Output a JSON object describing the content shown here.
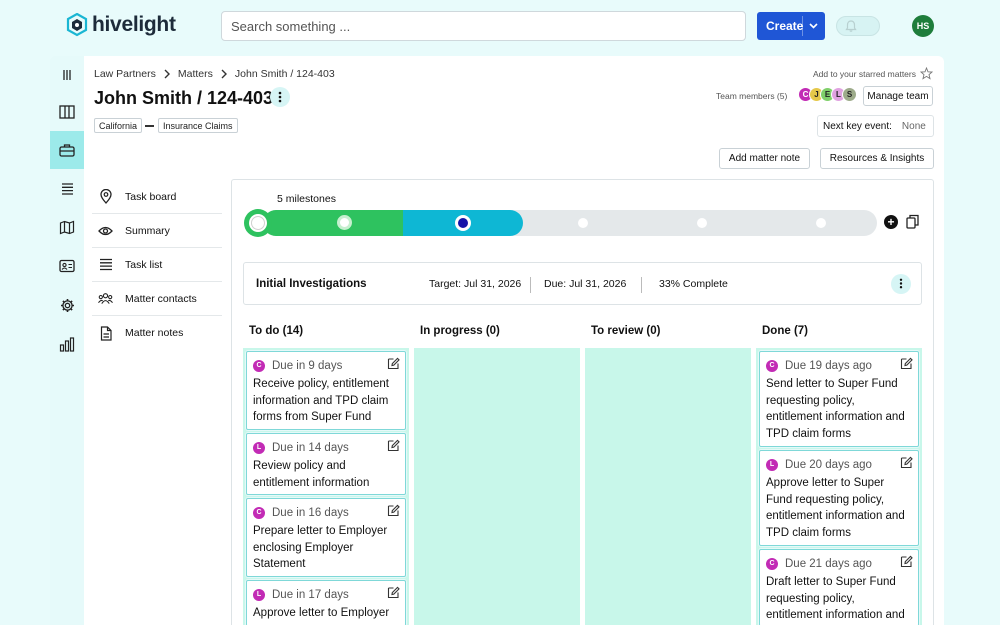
{
  "app": {
    "logo_text": "hivelight"
  },
  "search": {
    "placeholder": "Search something ..."
  },
  "header": {
    "create_label": "Create",
    "user_initials": "HS"
  },
  "breadcrumb": [
    "Law Partners",
    "Matters",
    "John Smith / 124-403"
  ],
  "matter": {
    "title": "John Smith / 124-403",
    "tags": [
      "California",
      "Insurance Claims"
    ],
    "starred_label": "Add to your starred matters",
    "team_label": "Team members (5)",
    "team_members": [
      "C",
      "J",
      "E",
      "L",
      "S"
    ],
    "manage_team_label": "Manage team",
    "next_key_event_label": "Next key event:",
    "next_key_event_value": "None",
    "add_note_label": "Add matter note",
    "resources_label": "Resources & Insights"
  },
  "colors": {
    "accent": "#1f56d6",
    "milestone_done": "#2ec25f",
    "milestone_current": "#0eb7d4",
    "column_bg": "#c8f7ea",
    "avatar_c": "#c22bb5",
    "avatar_l": "#c22bb5"
  },
  "sidenav": [
    {
      "label": "Task board",
      "icon": "location-pin-icon"
    },
    {
      "label": "Summary",
      "icon": "eye-icon"
    },
    {
      "label": "Task list",
      "icon": "list-icon"
    },
    {
      "label": "Matter contacts",
      "icon": "people-icon"
    },
    {
      "label": "Matter notes",
      "icon": "document-icon"
    }
  ],
  "milestones": {
    "label": "5 milestones",
    "current": {
      "title": "Initial Investigations",
      "target": "Target: Jul 31, 2026",
      "due": "Due: Jul 31, 2026",
      "complete": "33% Complete"
    }
  },
  "columns": [
    {
      "title": "To do (14)"
    },
    {
      "title": "In progress (0)"
    },
    {
      "title": "To review (0)"
    },
    {
      "title": "Done (7)"
    }
  ],
  "todo_tasks": [
    {
      "assignee": "C",
      "due": "Due in 9 days",
      "title": "Receive policy, entitlement information and TPD claim forms from Super Fund"
    },
    {
      "assignee": "L",
      "due": "Due in 14 days",
      "title": "Review policy and entitlement information"
    },
    {
      "assignee": "C",
      "due": "Due in 16 days",
      "title": "Prepare letter to Employer enclosing Employer Statement"
    },
    {
      "assignee": "L",
      "due": "Due in 17 days",
      "title": "Approve letter to Employer"
    }
  ],
  "done_tasks": [
    {
      "assignee": "C",
      "due": "Due 19 days ago",
      "title": "Send letter to Super Fund requesting policy, entitlement information and TPD claim forms"
    },
    {
      "assignee": "L",
      "due": "Due 20 days ago",
      "title": "Approve letter to Super Fund requesting policy, entitlement information and TPD claim forms"
    },
    {
      "assignee": "C",
      "due": "Due 21 days ago",
      "title": "Draft letter to Super Fund requesting policy, entitlement information and"
    }
  ]
}
